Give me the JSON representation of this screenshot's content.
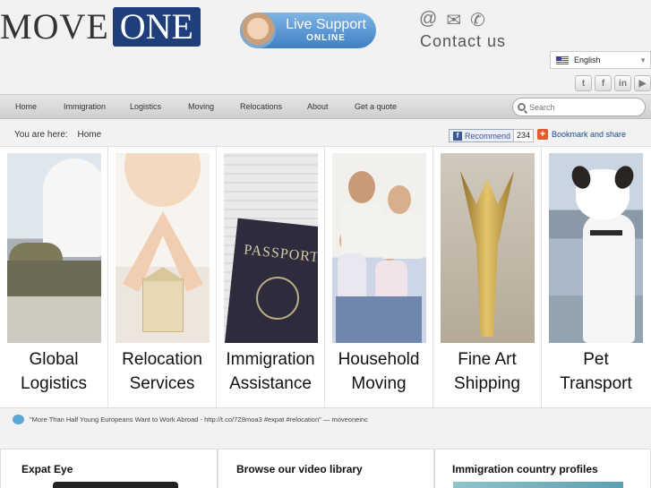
{
  "brand": {
    "logo_word1": "MOVE",
    "logo_word2": "ONE",
    "accent": "#1f3f7c"
  },
  "support": {
    "line1": "Live Support",
    "line2": "ONLINE"
  },
  "contact": {
    "icons": [
      "at-icon",
      "envelope-icon",
      "phone-icon"
    ],
    "label": "Contact us"
  },
  "language": {
    "selected": "English"
  },
  "social": [
    "twitter-icon",
    "facebook-icon",
    "linkedin-icon",
    "youtube-icon"
  ],
  "nav": {
    "items": [
      "Home",
      "Immigration",
      "Logistics",
      "Moving",
      "Relocations",
      "About",
      "Get a quote"
    ],
    "search_placeholder": "Search"
  },
  "breadcrumb": {
    "prefix": "You are here:",
    "current": "Home"
  },
  "share": {
    "recommend": "Recommend",
    "count": "234",
    "bookmark": "Bookmark and share"
  },
  "tiles": [
    {
      "line1": "Global",
      "line2": "Logistics"
    },
    {
      "line1": "Relocation",
      "line2": "Services"
    },
    {
      "line1": "Immigration",
      "line2": "Assistance"
    },
    {
      "line1": "Household",
      "line2": "Moving"
    },
    {
      "line1": "Fine Art",
      "line2": "Shipping"
    },
    {
      "line1": "Pet",
      "line2": "Transport"
    }
  ],
  "tweet": {
    "text": "\"More Than Half Young Europeans Want to Work Abroad - http://t.co/7Z8moa3 #expat #relocation\" — moveoneinc"
  },
  "boxes": {
    "expat": "Expat Eye",
    "video": "Browse our video library",
    "profiles": "Immigration country profiles"
  }
}
